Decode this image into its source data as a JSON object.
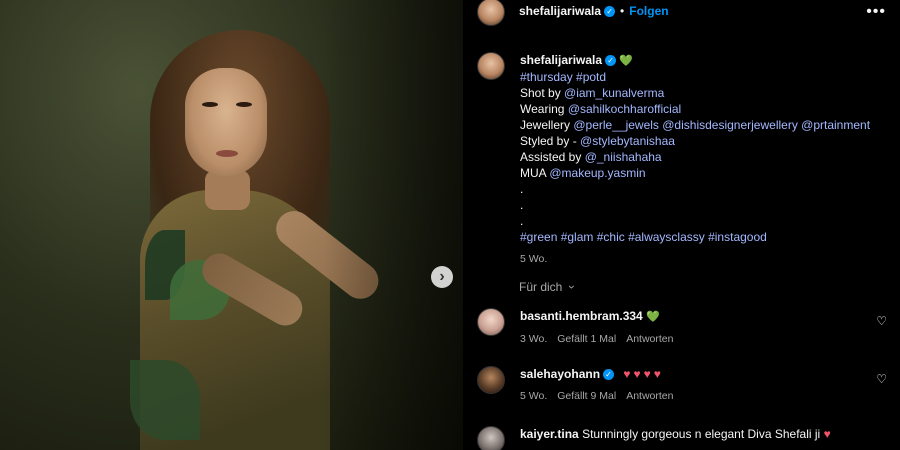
{
  "header": {
    "username": "shefalijariwala",
    "separator": "•",
    "follow_label": "Folgen",
    "more_icon": "more-horizontal-icon"
  },
  "caption": {
    "username": "shefalijariwala",
    "heart": "💚",
    "hashtags_top": "#thursday #potd",
    "shot_prefix": "Shot by ",
    "shot_link": "@iam_kunalverma",
    "wearing_prefix": "Wearing ",
    "wearing_link": "@sahilkochharofficial",
    "jewellery_prefix": "Jewellery ",
    "jewellery_links": "@perle__jewels @dishisdesignerjewellery @prtainment",
    "styled_prefix": "Styled by - ",
    "styled_link": "@stylebytanishaa",
    "assisted_prefix": "Assisted by ",
    "assisted_link": "@_niishahaha",
    "mua_prefix": "MUA ",
    "mua_link": "@makeup.yasmin",
    "dot1": ".",
    "dot2": ".",
    "dot3": ".",
    "hashtags_bottom": "#green #glam #chic #alwaysclassy #instagood",
    "time": "5 Wo."
  },
  "fur_dich": "Für dich",
  "comments": [
    {
      "username": "basanti.hembram.334",
      "text": "💚",
      "time": "3 Wo.",
      "likes": "Gefällt 1 Mal",
      "reply": "Antworten"
    },
    {
      "username": "salehayohann",
      "text": "♥♥♥♥",
      "time": "5 Wo.",
      "likes": "Gefällt 9 Mal",
      "reply": "Antworten"
    }
  ],
  "cut_comment": {
    "username": "kaiyer.tina",
    "text": "Stunningly gorgeous n elegant Diva Shefali ji "
  },
  "colors": {
    "accent": "#0095f6",
    "link": "#a3b8ff",
    "muted": "#a8a8a8",
    "heart_red": "#f0546b",
    "heart_green": "#3ec97a"
  }
}
